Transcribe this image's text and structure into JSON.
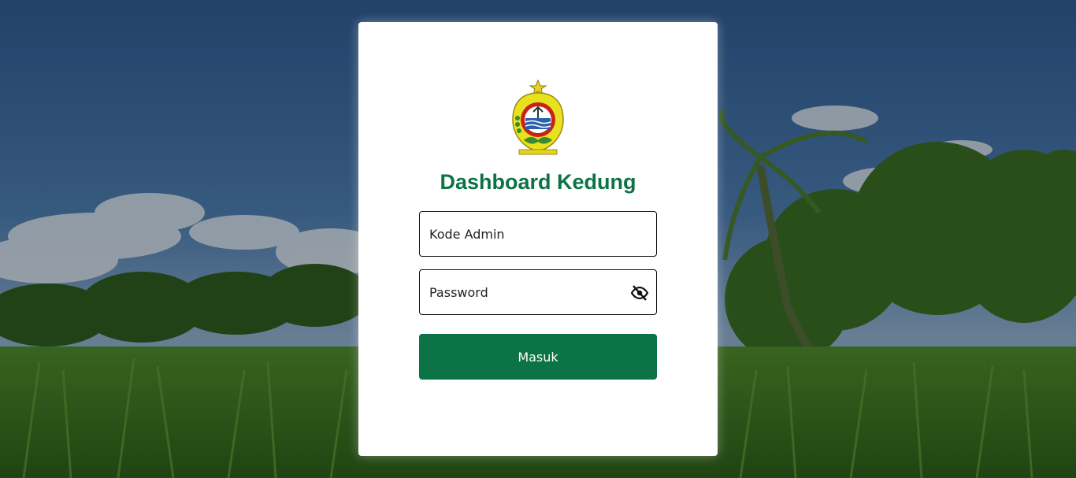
{
  "login": {
    "title": "Dashboard Kedung",
    "admin_code": {
      "placeholder": "Kode Admin",
      "value": ""
    },
    "password": {
      "placeholder": "Password",
      "value": "",
      "toggle_icon": "eye-slash-icon"
    },
    "submit_label": "Masuk"
  },
  "logo": {
    "name": "kedung-regency-emblem"
  },
  "colors": {
    "brand_green": "#0b7345",
    "card": "#ffffff",
    "input_border": "#111111"
  }
}
